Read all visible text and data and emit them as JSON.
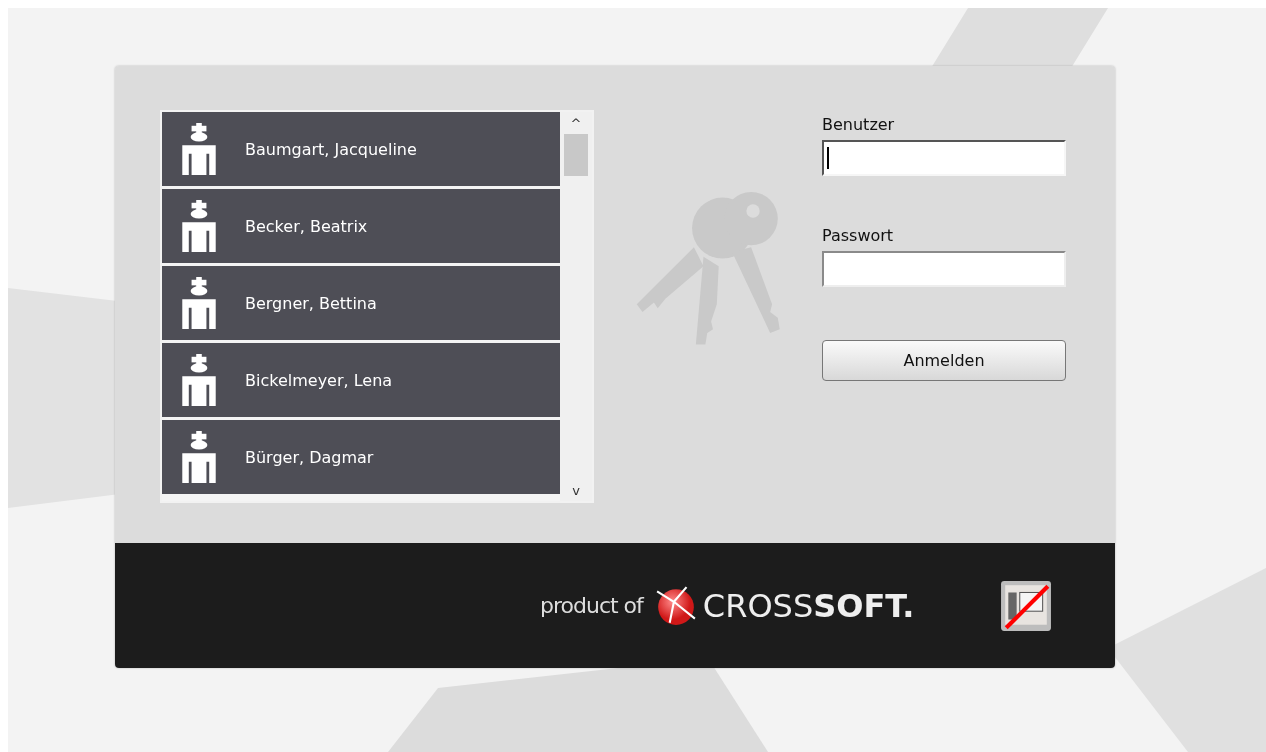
{
  "users": [
    {
      "name": "Baumgart, Jacqueline"
    },
    {
      "name": "Becker, Beatrix"
    },
    {
      "name": "Bergner, Bettina"
    },
    {
      "name": "Bickelmeyer, Lena"
    },
    {
      "name": "Bürger, Dagmar"
    }
  ],
  "scrollbar": {
    "up": "^",
    "down": "v"
  },
  "fields": [
    {
      "label": "Benutzer",
      "focused": true
    },
    {
      "label": "Passwort",
      "focused": false
    }
  ],
  "login_button": "Anmelden",
  "footer": {
    "product_of": "product of",
    "brand": "CROSS**SOFT.**"
  }
}
